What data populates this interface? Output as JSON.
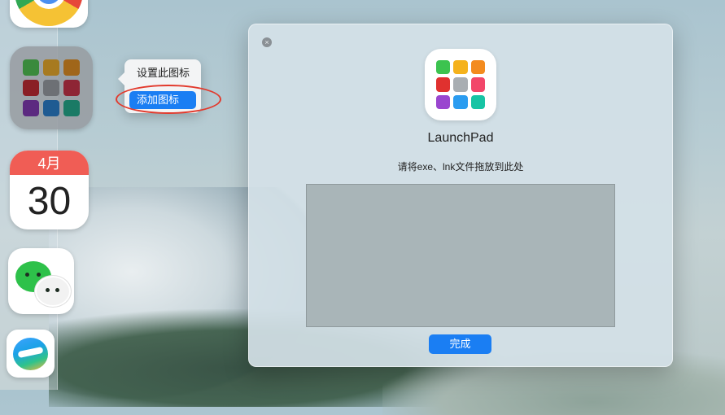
{
  "dock": {
    "calendar_month": "4月",
    "calendar_day": "30"
  },
  "context_menu": {
    "items": [
      {
        "label": "设置此图标",
        "active": false
      },
      {
        "label": "添加图标",
        "active": true
      }
    ]
  },
  "dialog": {
    "close_symbol": "×",
    "app_name": "LaunchPad",
    "instruction": "请将exe、lnk文件拖放到此处",
    "done_button": "完成"
  },
  "launchpad_icon_colors": [
    "#3cc34f",
    "#f5b21c",
    "#f38b1f",
    "#e0312f",
    "#a9aeb2",
    "#f2476a",
    "#9a46cf",
    "#2b9cf0",
    "#17c4a4"
  ],
  "dock_launchpad_colors": [
    "#3a8a3c",
    "#a77a20",
    "#a0661a",
    "#8a1f25",
    "#6d7075",
    "#8e2535",
    "#5c2a80",
    "#1f5b92",
    "#1a7a65"
  ],
  "colors": {
    "accent": "#1a7ef3",
    "annotation": "#e23a2d"
  }
}
